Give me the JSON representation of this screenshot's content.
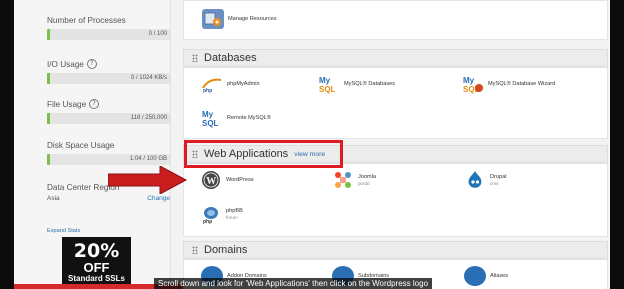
{
  "sidebar": {
    "stats": [
      {
        "label": "Number of Processes",
        "value": "0 / 100",
        "info": false
      },
      {
        "label": "I/O Usage",
        "value": "0 / 1024 KB/s",
        "info": true
      },
      {
        "label": "File Usage",
        "value": "118 / 250,000",
        "info": true
      },
      {
        "label": "Disk Space Usage",
        "value": "1.04 / 100 GB",
        "info": false
      }
    ],
    "data_center": {
      "label": "Data Center Region",
      "value": "Asia",
      "change_label": "Change"
    },
    "expand_stats_label": "Expand Stats",
    "promo": {
      "headline": "20%",
      "subline": "OFF",
      "tagline": "Standard SSLs"
    }
  },
  "main": {
    "top_item": {
      "label": "Manage Resources",
      "icon": "gear-icon"
    },
    "databases": {
      "title": "Databases",
      "items": [
        {
          "label": "phpMyAdmin",
          "icon": "phpmyadmin-icon"
        },
        {
          "label": "MySQL® Databases",
          "icon": "mysql-icon"
        },
        {
          "label": "MySQL® Database Wizard",
          "icon": "mysql-wizard-icon"
        },
        {
          "label": "Remote MySQL®",
          "icon": "remote-mysql-icon"
        }
      ]
    },
    "web_apps": {
      "title": "Web Applications",
      "view_more": "view more",
      "items": [
        {
          "label": "WordPress",
          "sub": "",
          "icon": "wordpress-icon"
        },
        {
          "label": "Joomla",
          "sub": "portal",
          "icon": "joomla-icon"
        },
        {
          "label": "Drupal",
          "sub": "cms",
          "icon": "drupal-icon"
        },
        {
          "label": "phpBB",
          "sub": "forum",
          "icon": "phpbb-icon"
        }
      ]
    },
    "domains": {
      "title": "Domains",
      "items": [
        {
          "label": "Addon Domains",
          "icon": "addon-domain-icon"
        },
        {
          "label": "Subdomains",
          "icon": "subdomain-icon"
        },
        {
          "label": "Aliases",
          "icon": "alias-icon"
        }
      ]
    }
  },
  "caption": "Scroll down and look for 'Web Applications' then click on the Wordpress logo",
  "colors": {
    "highlight": "#e01a22",
    "arrow": "#c81e1e",
    "bar_fill": "#7cc04a",
    "link": "#2a6fb3"
  }
}
